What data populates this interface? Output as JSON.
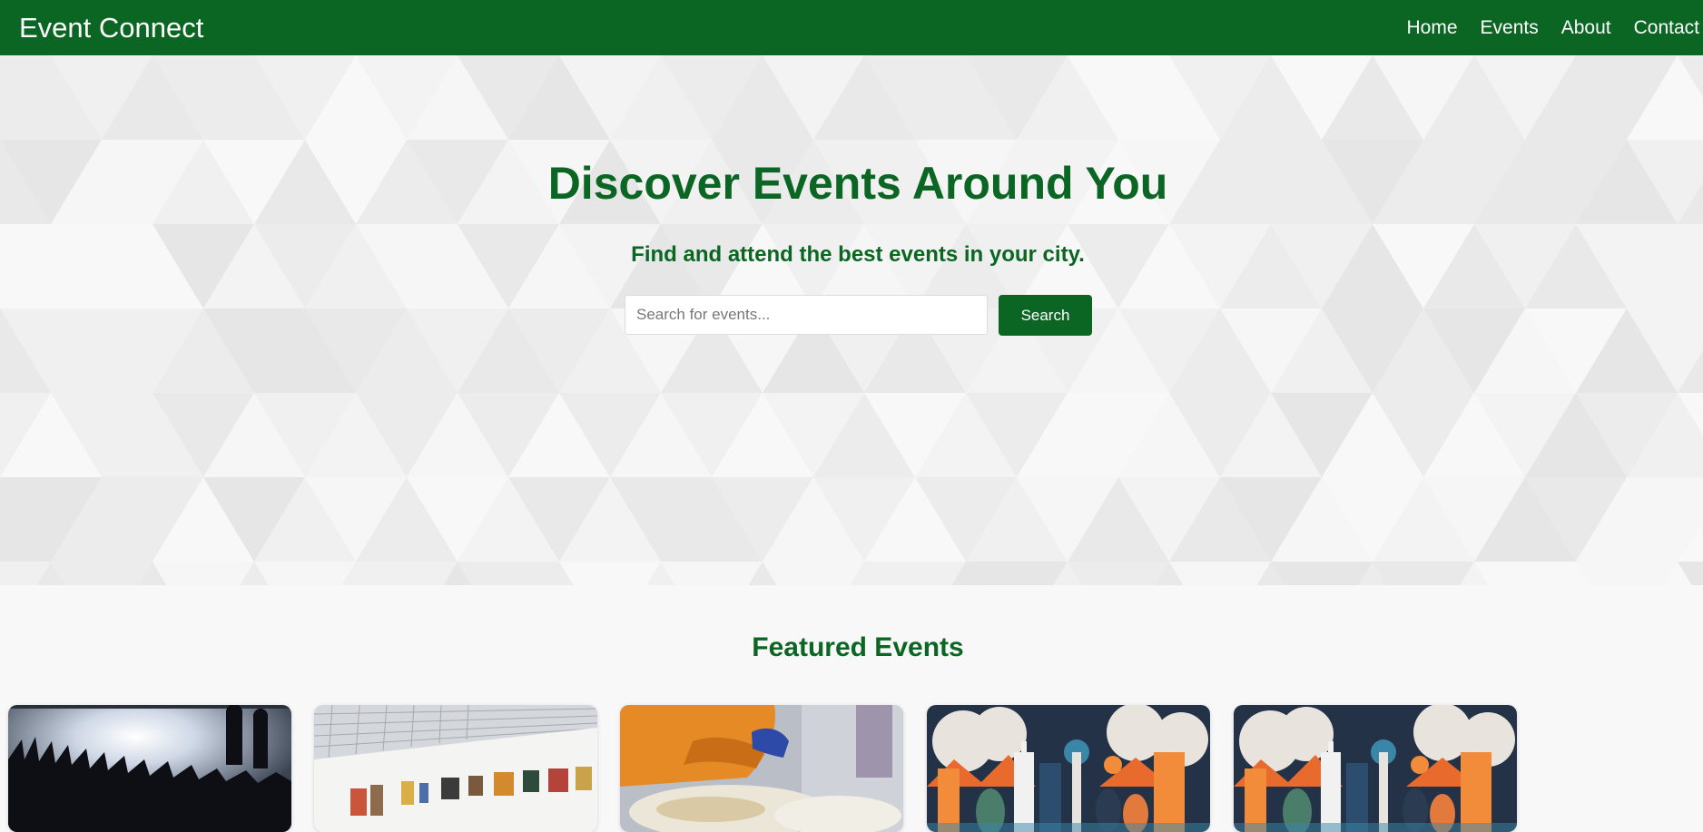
{
  "header": {
    "brand": "Event Connect",
    "nav": [
      "Home",
      "Events",
      "About",
      "Contact"
    ]
  },
  "hero": {
    "title": "Discover Events Around You",
    "subtitle": "Find and attend the best events in your city.",
    "search": {
      "placeholder": "Search for events...",
      "value": "",
      "button_label": "Search"
    }
  },
  "featured": {
    "title": "Featured Events",
    "cards": [
      {
        "image": "concert-crowd-photo"
      },
      {
        "image": "art-gallery-photo"
      },
      {
        "image": "food-serving-photo"
      },
      {
        "image": "city-illustration"
      },
      {
        "image": "city-illustration"
      }
    ]
  },
  "colors": {
    "brand_green": "#0b6623",
    "nav_text": "#ffffff",
    "hero_bg": "#f4f4f4",
    "page_bg": "#f8f8f8"
  }
}
